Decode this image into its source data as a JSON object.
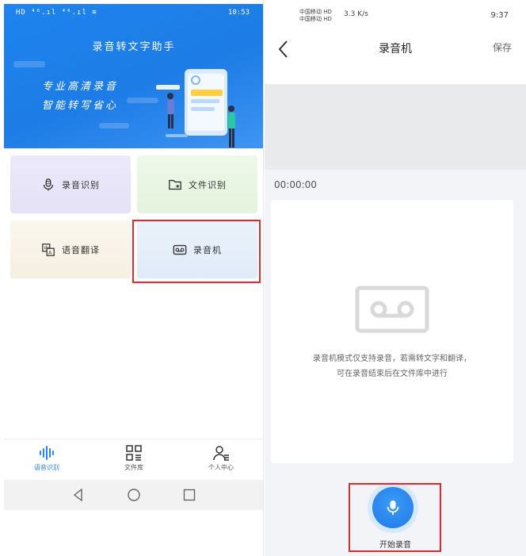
{
  "colors": {
    "primary_blue": "#1f84ee",
    "highlight_red": "#e02a2a"
  },
  "left": {
    "status_bar": {
      "left_icons": "HD ⁴⁶.ıl ⁴⁶.ıl ≋",
      "time": "10:53"
    },
    "header": {
      "title": "录音转文字助手",
      "slogan_line1": "专业高清录音",
      "slogan_line2": "智能转写省心"
    },
    "features": [
      {
        "label": "录音识别",
        "icon": "microphone-icon"
      },
      {
        "label": "文件识别",
        "icon": "folder-icon"
      },
      {
        "label": "语音翻译",
        "icon": "translate-icon"
      },
      {
        "label": "录音机",
        "icon": "tape-recorder-icon"
      }
    ],
    "tabs": [
      {
        "label": "语音识别",
        "icon": "waveform-icon",
        "active": true
      },
      {
        "label": "文件库",
        "icon": "grid-list-icon",
        "active": false
      },
      {
        "label": "个人中心",
        "icon": "person-icon",
        "active": false
      }
    ]
  },
  "right": {
    "status_bar": {
      "carrier_line1": "中国移动 HD",
      "carrier_line2": "中国移动 HD",
      "speed": "3.3 K/s",
      "time": "9:37"
    },
    "nav": {
      "title": "录音机",
      "save_label": "保存"
    },
    "timer": "00:00:00",
    "notice_line1": "录音机模式仅支持录音，若需转文字和翻译，",
    "notice_line2": "可在录音结束后在文件库中进行",
    "record_label": "开始录音"
  }
}
